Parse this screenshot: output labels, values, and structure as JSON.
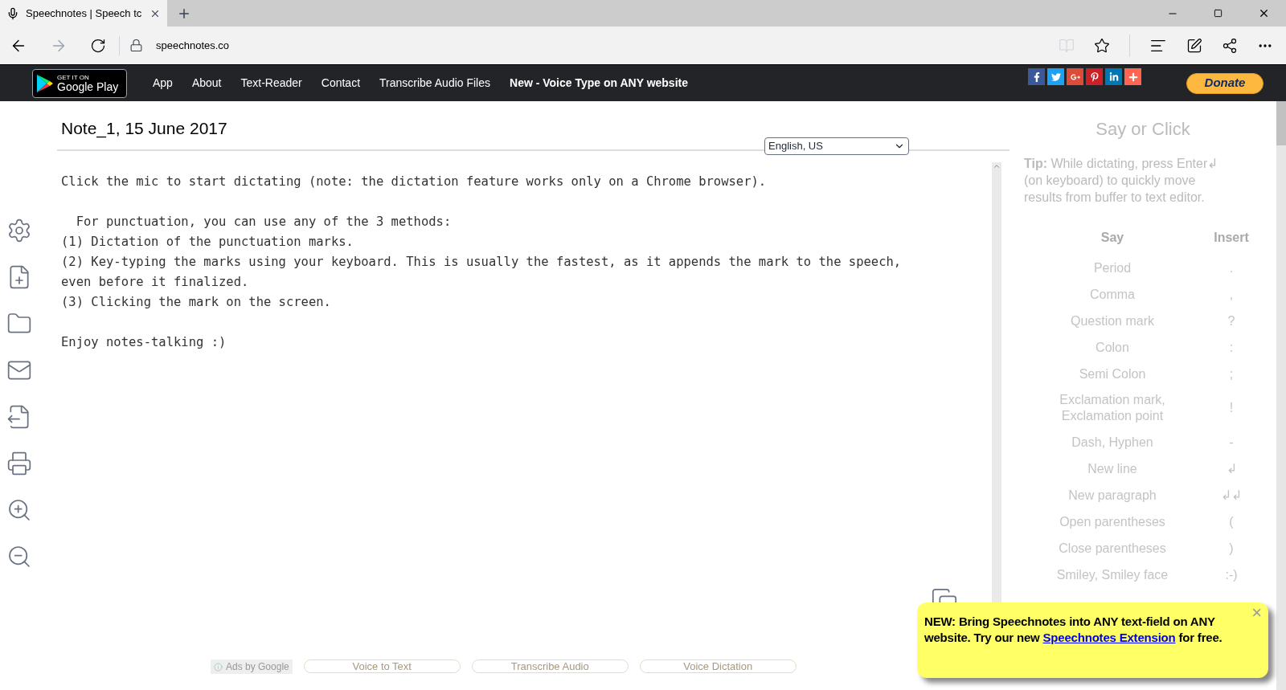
{
  "browser": {
    "tab_title": "Speechnotes | Speech tc",
    "address": "speechnotes.co"
  },
  "nav": {
    "badge_top": "GET IT ON",
    "badge_main": "Google Play",
    "links": [
      {
        "label": "App",
        "bold": false
      },
      {
        "label": "About",
        "bold": false
      },
      {
        "label": "Text-Reader",
        "bold": false
      },
      {
        "label": "Contact",
        "bold": false
      },
      {
        "label": "Transcribe Audio Files",
        "bold": false
      },
      {
        "label": "New - Voice Type on ANY website",
        "bold": true
      }
    ],
    "donate": "Donate"
  },
  "note": {
    "title": "Note_1, 15 June 2017",
    "language": "English, US",
    "text": "Click the mic to start dictating (note: the dictation feature works only on a Chrome browser).\n\n  For punctuation, you can use any of the 3 methods:\n(1) Dictation of the punctuation marks.\n(2) Key-typing the marks using your keyboard. This is usually the fastest, as it appends the mark to the speech, even before it finalized.\n(3) Clicking the mark on the screen.\n\nEnjoy notes-talking :)"
  },
  "ads": {
    "label": "Ads by Google",
    "links": [
      "Voice to Text",
      "Transcribe Audio",
      "Voice Dictation"
    ]
  },
  "side": {
    "title": "Say or Click",
    "tip": "**Tip:** While dictating, press Enter↲ (on keyboard) to quickly move results from buffer to text editor.",
    "columns": [
      "Say",
      "Insert"
    ],
    "rows": [
      {
        "say": "Period",
        "insert": "."
      },
      {
        "say": "Comma",
        "insert": ","
      },
      {
        "say": "Question mark",
        "insert": "?"
      },
      {
        "say": "Colon",
        "insert": ":"
      },
      {
        "say": "Semi Colon",
        "insert": ";"
      },
      {
        "say": "Exclamation mark, Exclamation point",
        "insert": "!"
      },
      {
        "say": "Dash, Hyphen",
        "insert": "-"
      },
      {
        "say": "New line",
        "insert": "↲"
      },
      {
        "say": "New paragraph",
        "insert": "↲↲"
      },
      {
        "say": "Open parentheses",
        "insert": "("
      },
      {
        "say": "Close parentheses",
        "insert": ")"
      },
      {
        "say": "Smiley, Smiley face",
        "insert": ":-)"
      }
    ]
  },
  "popup": {
    "text_before": "NEW: Bring Speechnotes into ANY text-field on ANY website. Try our new ",
    "link": "Speechnotes Extension",
    "text_after": " for free.",
    "close": "×"
  }
}
